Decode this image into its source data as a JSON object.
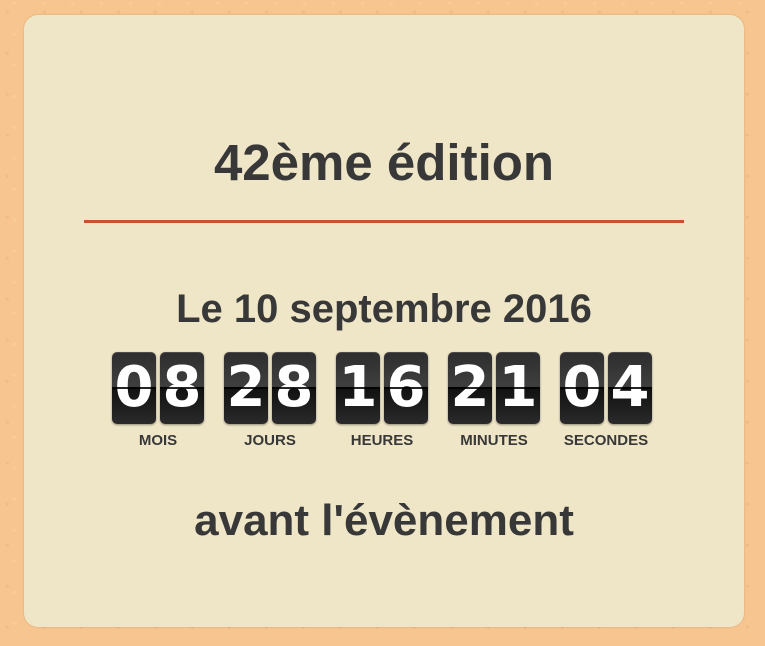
{
  "edition": "42ème édition",
  "date_text": "Le 10 septembre 2016",
  "countdown": [
    {
      "digits": [
        "0",
        "8"
      ],
      "label": "MOIS"
    },
    {
      "digits": [
        "2",
        "8"
      ],
      "label": "JOURS"
    },
    {
      "digits": [
        "1",
        "6"
      ],
      "label": "HEURES"
    },
    {
      "digits": [
        "2",
        "1"
      ],
      "label": "MINUTES"
    },
    {
      "digits": [
        "0",
        "4"
      ],
      "label": "SECONDES"
    }
  ],
  "footer_text": "avant l'évènement",
  "colors": {
    "page_bg": "#f7c690",
    "card_bg": "#efe6c8",
    "divider": "#c8532a",
    "text": "#383838",
    "digit_bg": "#2d2d2d"
  }
}
